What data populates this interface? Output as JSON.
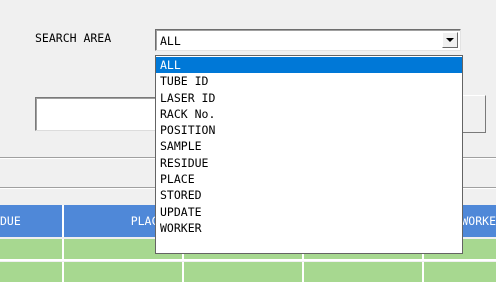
{
  "search": {
    "label": "SEARCH AREA",
    "selected_value": "ALL",
    "options": [
      "ALL",
      "TUBE ID",
      "LASER ID",
      "RACK No.",
      "POSITION",
      "SAMPLE",
      "RESIDUE",
      "PLACE",
      "STORED",
      "UPDATE",
      "WORKER"
    ],
    "highlighted_index": 0
  },
  "search_input": {
    "value": ""
  },
  "grid": {
    "columns": [
      "DUE",
      "PLACE",
      "",
      "",
      "WORKE"
    ],
    "header_color": "#4f88d8",
    "row_color": "#a7d890"
  },
  "colors": {
    "selection": "#0078d7",
    "background": "#f0f0f0"
  }
}
